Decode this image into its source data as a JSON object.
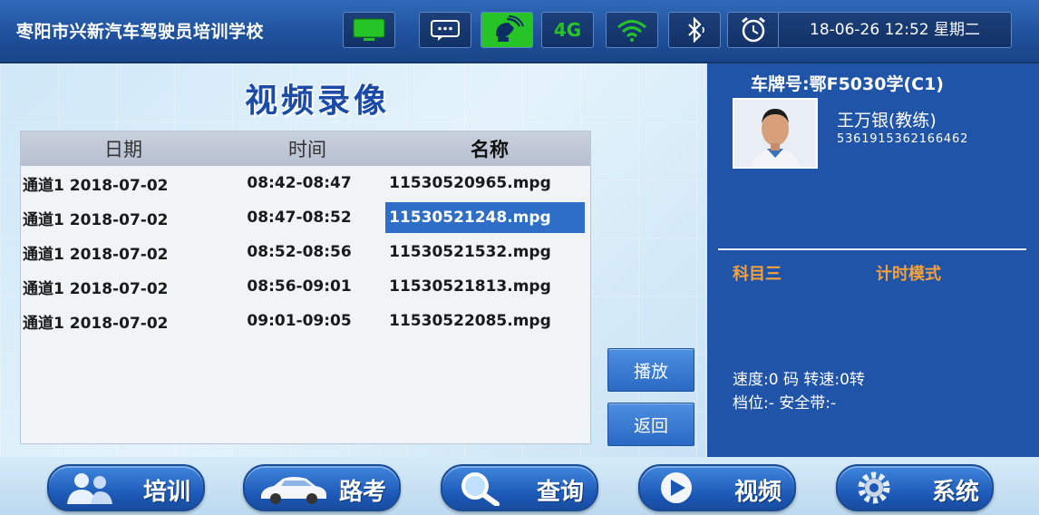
{
  "header": {
    "school_name": "枣阳市兴新汽车驾驶员培训学校",
    "datetime": "18-06-26 12:52 星期二",
    "icons": [
      "monitor-icon",
      "message-icon",
      "satellite-icon",
      "4g-icon",
      "wifi-icon",
      "bluetooth-icon",
      "alarm-clock-icon"
    ],
    "four_g_label": "4G"
  },
  "main": {
    "title": "视频录像",
    "columns": {
      "date": "日期",
      "time": "时间",
      "name": "名称"
    },
    "rows": [
      {
        "date": "通道1 2018-07-02",
        "time": "08:42-08:47",
        "name": "11530520965.mpg",
        "selected": false
      },
      {
        "date": "通道1 2018-07-02",
        "time": "08:47-08:52",
        "name": "11530521248.mpg",
        "selected": true
      },
      {
        "date": "通道1 2018-07-02",
        "time": "08:52-08:56",
        "name": "11530521532.mpg",
        "selected": false
      },
      {
        "date": "通道1 2018-07-02",
        "time": "08:56-09:01",
        "name": "11530521813.mpg",
        "selected": false
      },
      {
        "date": "通道1 2018-07-02",
        "time": "09:01-09:05",
        "name": "11530522085.mpg",
        "selected": false
      }
    ],
    "play_label": "播放",
    "back_label": "返回"
  },
  "info": {
    "plate": "车牌号:鄂F5030学(C1)",
    "coach_name": "王万银(教练)",
    "coach_id": "5361915362166462",
    "subject": "科目三",
    "mode": "计时模式",
    "speed_text": "速度:0 码 转速:0转",
    "gear_text": "档位:- 安全带:-"
  },
  "nav": [
    {
      "label": "培训",
      "icon": "users-icon"
    },
    {
      "label": "路考",
      "icon": "car-icon"
    },
    {
      "label": "查询",
      "icon": "magnifier-icon"
    },
    {
      "label": "视频",
      "icon": "play-icon"
    },
    {
      "label": "系统",
      "icon": "gear-icon"
    }
  ],
  "colors": {
    "header_bg": "#1e4f9a",
    "accent_orange": "#f6a23b",
    "selection": "#2e6ec6",
    "panel_blue": "#1f54a9"
  }
}
